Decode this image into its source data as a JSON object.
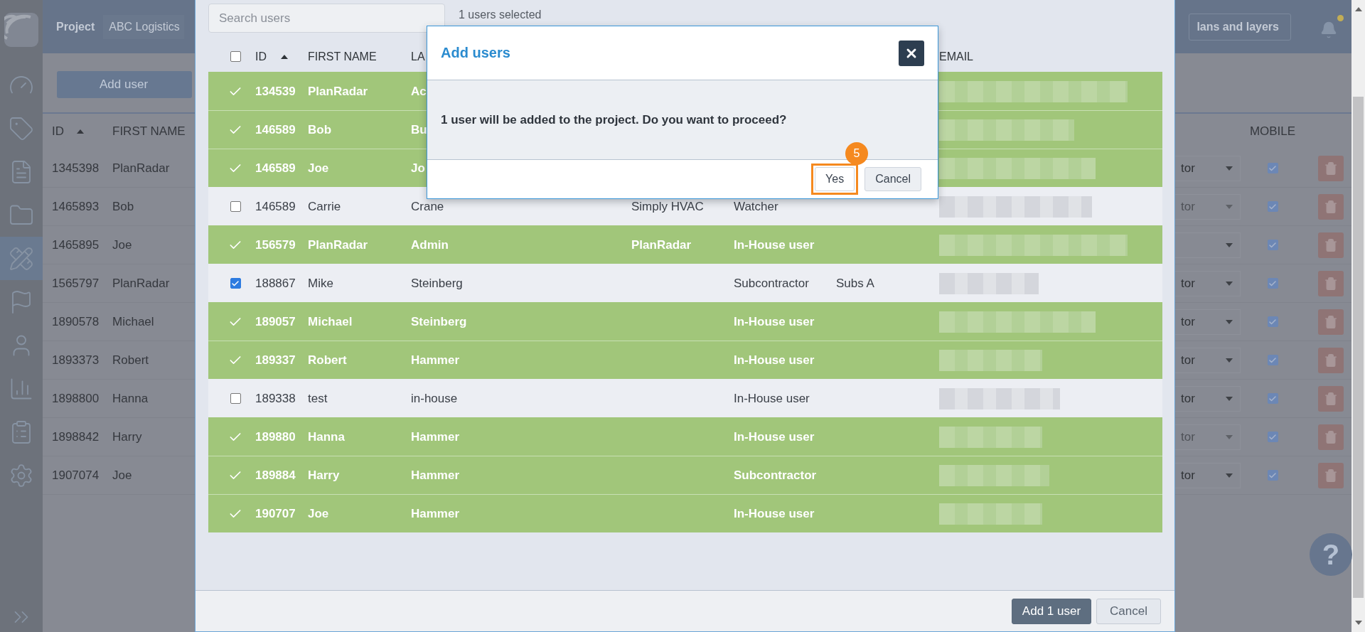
{
  "sidebar": {
    "items": [
      {
        "selected": false
      },
      {
        "selected": false
      },
      {
        "selected": false
      },
      {
        "selected": false
      },
      {
        "selected": true
      },
      {
        "selected": false
      },
      {
        "selected": false
      },
      {
        "selected": false
      },
      {
        "selected": false
      },
      {
        "selected": false
      }
    ]
  },
  "header": {
    "breadcrumb": [
      "Project",
      "ABC Logistics"
    ],
    "plans_button": "lans and layers",
    "has_notification": true
  },
  "page": {
    "add_button": "Add user",
    "columns": {
      "id": "ID",
      "first_name": "FIRST NAME",
      "mobile": "MOBILE"
    },
    "id_sorted_ascending": true,
    "rows": [
      {
        "id": "1345398",
        "first_name": "PlanRadar",
        "role": "tor",
        "role_disabled": false,
        "mobile": true
      },
      {
        "id": "1465893",
        "first_name": "Bob",
        "role": "tor",
        "role_disabled": true,
        "mobile": true
      },
      {
        "id": "1465895",
        "first_name": "Joe",
        "role_disabled": false,
        "mobile": true
      },
      {
        "id": "1565797",
        "first_name": "PlanRadar",
        "role": "tor",
        "role_disabled": false,
        "mobile": true
      },
      {
        "id": "1890578",
        "first_name": "Michael",
        "role": "tor",
        "role_disabled": false,
        "mobile": true
      },
      {
        "id": "1893373",
        "first_name": "Robert",
        "role": "tor",
        "role_disabled": false,
        "mobile": true
      },
      {
        "id": "1898800",
        "first_name": "Hanna",
        "role": "tor",
        "role_disabled": false,
        "mobile": true
      },
      {
        "id": "1898842",
        "first_name": "Harry",
        "role": "tor",
        "role_disabled": true,
        "mobile": true
      },
      {
        "id": "1907074",
        "first_name": "Joe",
        "role": "tor",
        "role_disabled": false,
        "mobile": true
      }
    ],
    "help_button": "?"
  },
  "modal": {
    "search": {
      "placeholder": "Search users"
    },
    "selection_count": "1 users selected",
    "header": {
      "select_all_checked": false,
      "id": "ID",
      "id_sorted_ascending": true,
      "first_name": "FIRST NAME",
      "last_name": "LA",
      "email": "EMAIL"
    },
    "rows": [
      {
        "kind": "added",
        "id": "134539",
        "first_name": "PlanRadar",
        "last_name": "Ac"
      },
      {
        "kind": "added",
        "id": "146589",
        "first_name": "Bob",
        "last_name": "Bu"
      },
      {
        "kind": "added",
        "id": "146589",
        "first_name": "Joe",
        "last_name": "Jo"
      },
      {
        "kind": "selectable",
        "checked": false,
        "id": "146589",
        "first_name": "Carrie",
        "last_name": "Crane",
        "company": "Simply HVAC",
        "role": "Watcher"
      },
      {
        "kind": "added",
        "id": "156579",
        "first_name": "PlanRadar",
        "last_name": "Admin",
        "company": "PlanRadar",
        "role": "In-House user"
      },
      {
        "kind": "selectable",
        "checked": true,
        "id": "188867",
        "first_name": "Mike",
        "last_name": "Steinberg",
        "role": "Subcontractor",
        "group": "Subs A"
      },
      {
        "kind": "added",
        "id": "189057",
        "first_name": "Michael",
        "last_name": "Steinberg",
        "role": "In-House user"
      },
      {
        "kind": "added",
        "id": "189337",
        "first_name": "Robert",
        "last_name": "Hammer",
        "role": "In-House user"
      },
      {
        "kind": "selectable",
        "checked": false,
        "id": "189338",
        "first_name": "test",
        "last_name": "in-house",
        "role": "In-House user"
      },
      {
        "kind": "added",
        "id": "189880",
        "first_name": "Hanna",
        "last_name": "Hammer",
        "role": "In-House user"
      },
      {
        "kind": "added",
        "id": "189884",
        "first_name": "Harry",
        "last_name": "Hammer",
        "role": "Subcontractor"
      },
      {
        "kind": "added",
        "id": "190707",
        "first_name": "Joe",
        "last_name": "Hammer",
        "role": "In-House user"
      }
    ],
    "footer": {
      "primary": "Add 1 user",
      "cancel": "Cancel"
    }
  },
  "dialog": {
    "title": "Add users",
    "message": "1 user will be added to the project. Do you want to proceed?",
    "step_badge": "5",
    "buttons": [
      {
        "label": "Yes",
        "highlighted": true
      },
      {
        "label": "Cancel",
        "highlighted": false
      }
    ]
  }
}
